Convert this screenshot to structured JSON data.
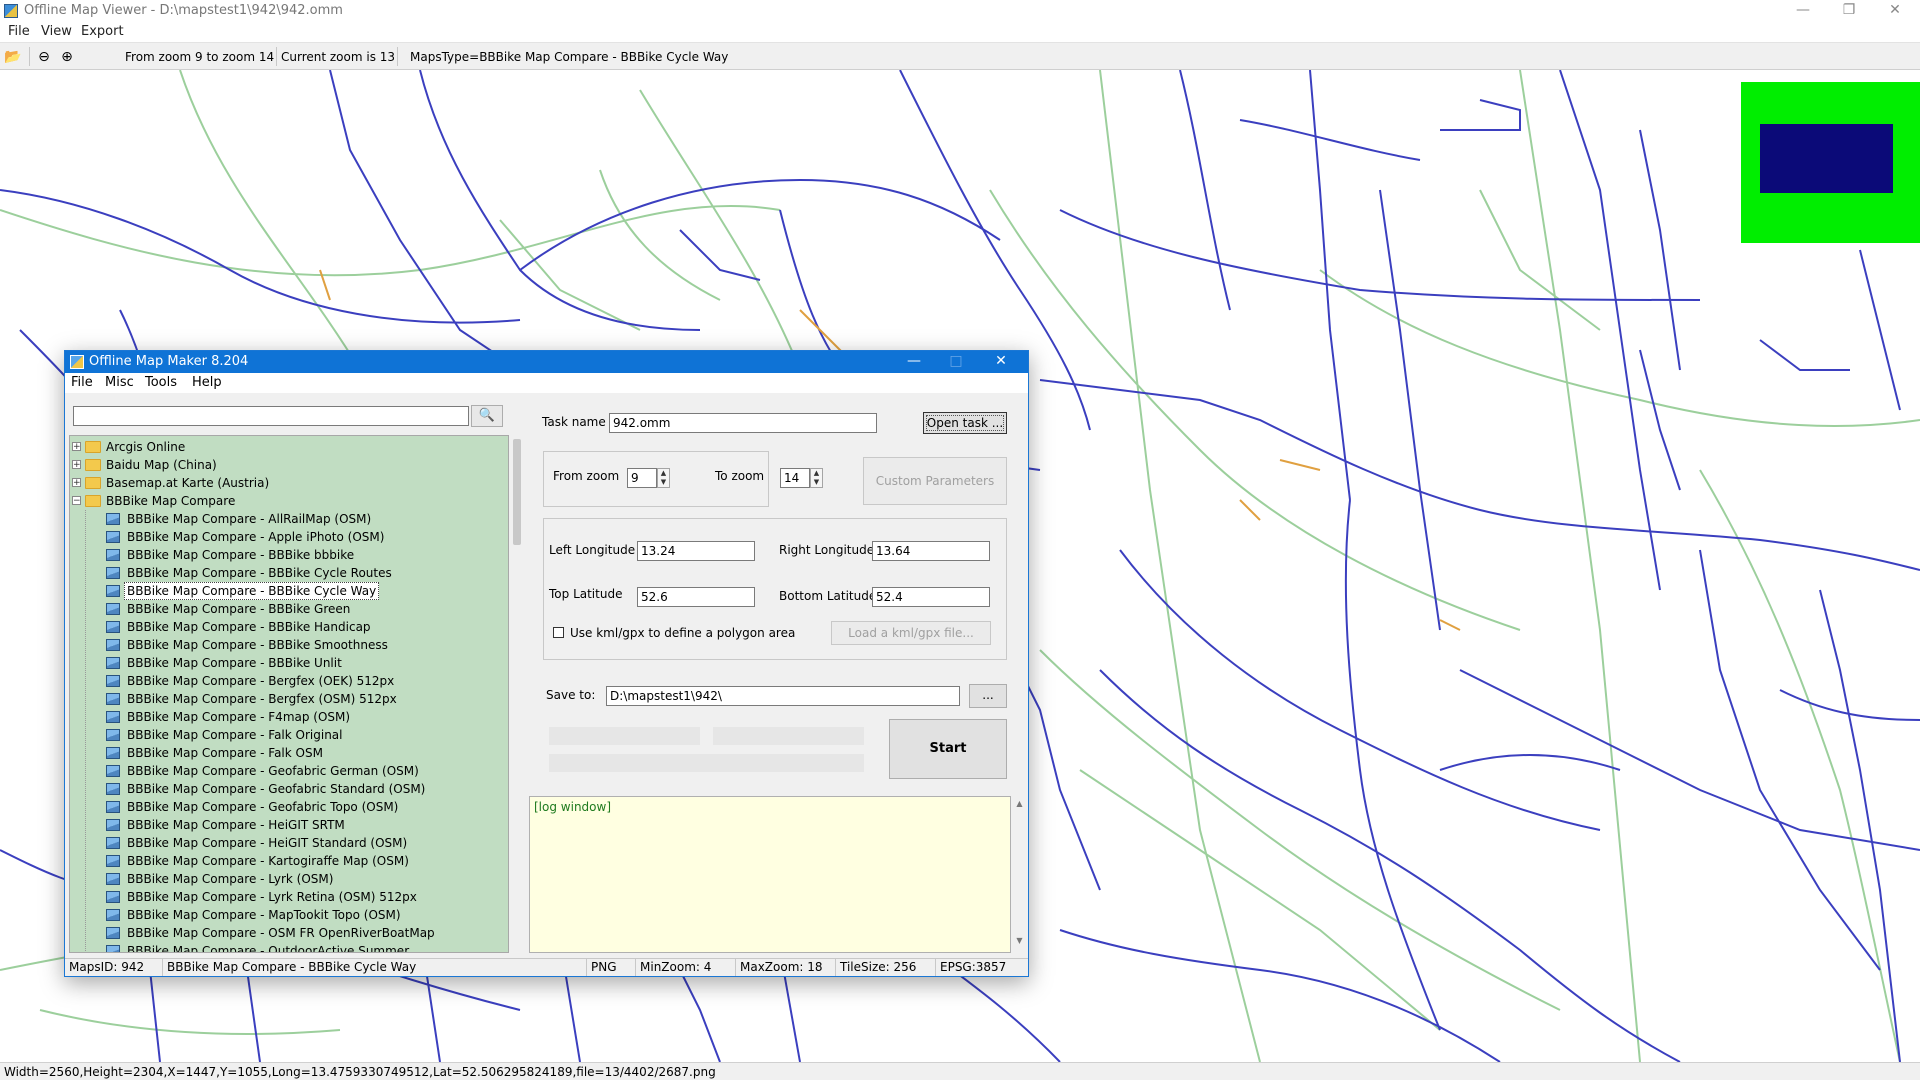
{
  "viewer": {
    "title": "Offline Map Viewer - D:\\mapstest1\\942\\942.omm",
    "menu": [
      "File",
      "View",
      "Export"
    ],
    "toolbar": {
      "zoom_range": "From zoom 9 to zoom 14",
      "current_zoom": "Current zoom is 13",
      "maps_type": "MapsType=BBBike Map Compare - BBBike Cycle Way"
    },
    "status": "Width=2560,Height=2304,X=1447,Y=1055,Long=13.4759330749512,Lat=52.506295824189,file=13/4402/2687.png",
    "minimap_colors": {
      "background": "#00ee00",
      "viewport": "#0b0a78"
    },
    "map_colors": {
      "blue_roads": "#3b3fbf",
      "green_roads": "#9ccf9c",
      "orange_roads": "#e0a040"
    }
  },
  "maker": {
    "title": "Offline Map Maker 8.204",
    "menu": [
      "File",
      "Misc",
      "Tools",
      "Help"
    ],
    "search": {
      "value": "",
      "icon": "search-icon"
    },
    "tree": {
      "folders": [
        {
          "label": "Arcgis Online",
          "expanded": false
        },
        {
          "label": "Baidu Map (China)",
          "expanded": false
        },
        {
          "label": "Basemap.at Karte (Austria)",
          "expanded": false
        },
        {
          "label": "BBBike Map Compare",
          "expanded": true
        }
      ],
      "items": [
        "BBBike Map Compare - AllRailMap (OSM)",
        "BBBike Map Compare - Apple iPhoto (OSM)",
        "BBBike Map Compare - BBBike bbbike",
        "BBBike Map Compare - BBBike Cycle Routes",
        "BBBike Map Compare - BBBike Cycle Way",
        "BBBike Map Compare - BBBike Green",
        "BBBike Map Compare - BBBike Handicap",
        "BBBike Map Compare - BBBike Smoothness",
        "BBBike Map Compare - BBBike Unlit",
        "BBBike Map Compare - Bergfex (OEK) 512px",
        "BBBike Map Compare - Bergfex (OSM) 512px",
        "BBBike Map Compare - F4map (OSM)",
        "BBBike Map Compare - Falk Original",
        "BBBike Map Compare - Falk OSM",
        "BBBike Map Compare - Geofabric German (OSM)",
        "BBBike Map Compare - Geofabric Standard (OSM)",
        "BBBike Map Compare - Geofabric Topo (OSM)",
        "BBBike Map Compare - HeiGIT SRTM",
        "BBBike Map Compare - HeiGIT Standard (OSM)",
        "BBBike Map Compare - Kartogiraffe Map (OSM)",
        "BBBike Map Compare - Lyrk (OSM)",
        "BBBike Map Compare - Lyrk Retina (OSM) 512px",
        "BBBike Map Compare - MapTookit Topo (OSM)",
        "BBBike Map Compare - OSM FR OpenRiverBoatMap",
        "BBBike Map Compare - OutdoorActive Summer"
      ],
      "selected_index": 4,
      "background": "#c1ddc2"
    },
    "form": {
      "task_name_label": "Task name",
      "task_name_value": "942.omm",
      "open_task_button": "Open task ...",
      "from_zoom_label": "From zoom",
      "from_zoom_value": "9",
      "to_zoom_label": "To zoom",
      "to_zoom_value": "14",
      "custom_parameters_button": "Custom Parameters",
      "left_longitude_label": "Left Longitude",
      "left_longitude_value": "13.24",
      "right_longitude_label": "Right Longitude",
      "right_longitude_value": "13.64",
      "top_latitude_label": "Top Latitude",
      "top_latitude_value": "52.6",
      "bottom_latitude_label": "Bottom Latitude",
      "bottom_latitude_value": "52.4",
      "kml_checkbox_label": "Use kml/gpx to define a polygon area",
      "kml_checked": false,
      "load_kml_button": "Load a kml/gpx file...",
      "save_to_label": "Save to:",
      "save_to_value": "D:\\mapstest1\\942\\",
      "browse_button": "...",
      "start_button": "Start",
      "log_text": "[log window]"
    },
    "status": {
      "maps_id": "MapsID: 942",
      "maps_name": "BBBike Map Compare - BBBike Cycle Way",
      "format": "PNG",
      "min_zoom": "MinZoom: 4",
      "max_zoom": "MaxZoom: 18",
      "tile_size": "TileSize: 256",
      "epsg": "EPSG:3857"
    }
  }
}
